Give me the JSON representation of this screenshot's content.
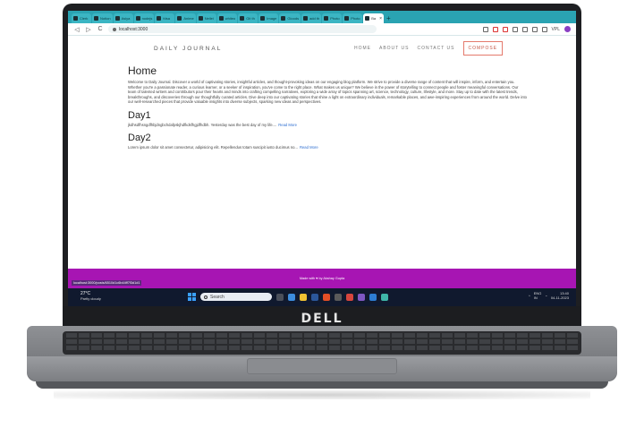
{
  "browser": {
    "tabs": [
      {
        "label": "Clerk"
      },
      {
        "label": "Notion"
      },
      {
        "label": "Asiya"
      },
      {
        "label": "nodejs"
      },
      {
        "label": "fdsa"
      },
      {
        "label": "Anime"
      },
      {
        "label": "Neilei"
      },
      {
        "label": "whiteo"
      },
      {
        "label": "Git th"
      },
      {
        "label": "Image"
      },
      {
        "label": "Gloods"
      },
      {
        "label": "add th"
      },
      {
        "label": "Photo"
      },
      {
        "label": "Photo"
      },
      {
        "label": "Ba",
        "active": true
      }
    ],
    "new_tab": "+",
    "url": "localhost:3000",
    "back": "◁",
    "forward": "▷",
    "reload": "C",
    "profile_label": "VPL"
  },
  "site": {
    "brand": "DAILY JOURNAL",
    "nav": {
      "home": "HOME",
      "about": "ABOUT US",
      "contact": "CONTACT US",
      "compose": "COMPOSE"
    },
    "home_title": "Home",
    "home_text": "Welcome to Daily Journal. Discover a world of captivating stories, insightful articles, and thought-provoking ideas on our engaging blog platform. We strive to provide a diverse range of content that will inspire, inform, and entertain you. Whether you're a passionate reader, a curious learner, or a seeker of inspiration, you've come to the right place. What makes us unique? We believe in the power of storytelling to connect people and foster meaningful conversations. Our team of talented writers and contributors pour their hearts and minds into crafting compelling narratives, exploring a wide array of topics spanning art, science, technology, culture, lifestyle, and more. Stay up to date with the latest trends, breakthroughs, and discoveries through our thoughtfully curated articles. Dive deep into our captivating stories that shine a light on extraordinary individuals, remarkable places, and awe-inspiring experiences from around the world. Delve into our well-researched pieces that provide valuable insights into diverse subjects, sparking new ideas and perspectives.",
    "posts": [
      {
        "title": "Day1",
        "excerpt": "jkdhsdfhsngdfhbjdngbchdafpskjhdfkdsfhgjdfhdbh. Yesterday was the best day of my life....",
        "link": "Read More"
      },
      {
        "title": "Day2",
        "excerpt": "Lorem ipsum dolor sit amet consectetur, adipisicing elit. Repellendus totam suscipit iusto ducimus no...",
        "link": "Read More"
      }
    ],
    "footer": "Made with ♥ by Akshay Gupta",
    "status_url": "localhost:3000/posts/6510d1c6b44ff7f3d1d1"
  },
  "taskbar": {
    "weather_temp": "27°C",
    "weather_desc": "Partly cloudy",
    "search_placeholder": "Search",
    "lang": "ENG",
    "region": "IN",
    "time": "13:40",
    "date": "04-11-2023"
  },
  "device": {
    "brand": "DELL"
  }
}
